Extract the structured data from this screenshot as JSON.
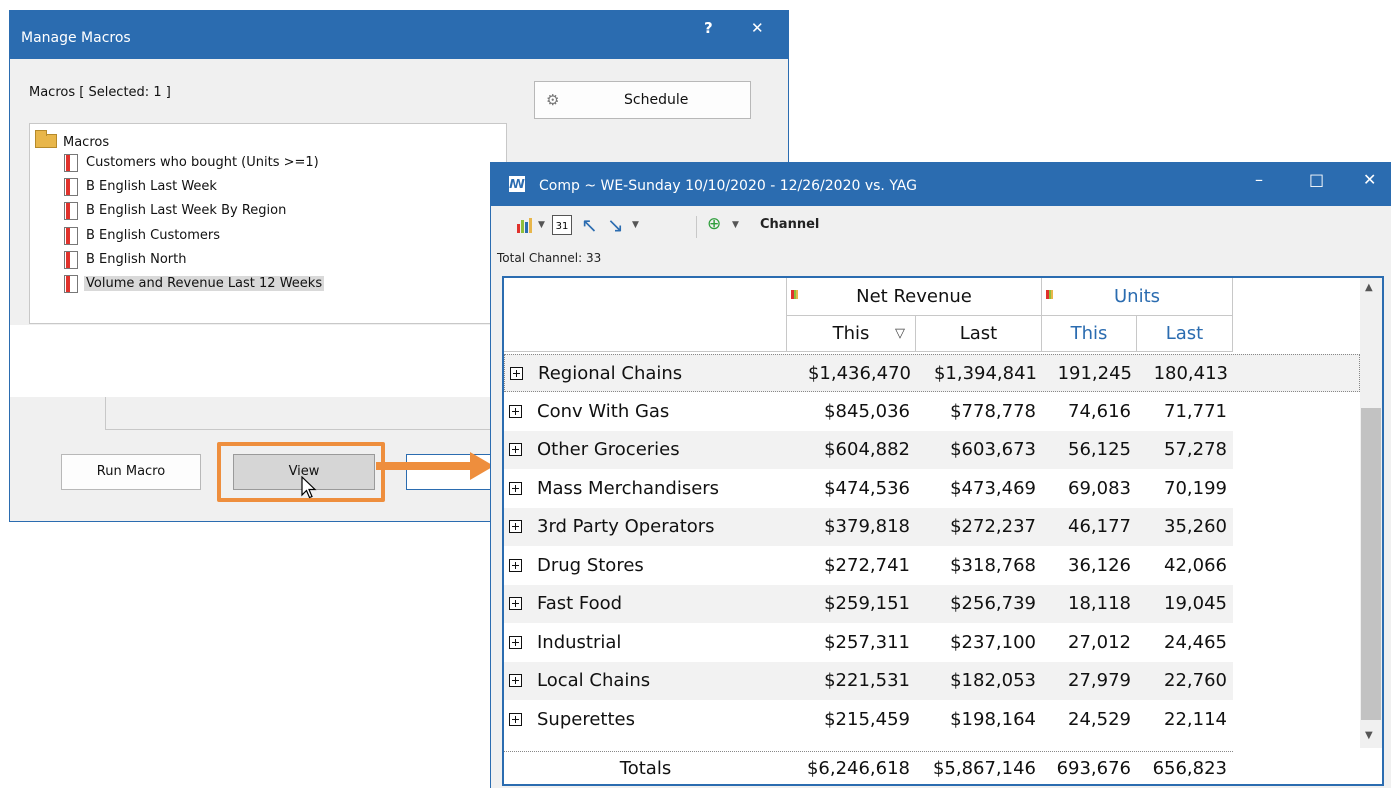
{
  "macro_dialog": {
    "title": "Manage Macros",
    "help_glyph": "?",
    "close_glyph": "✕",
    "selected_label": "Macros [ Selected: 1 ]",
    "schedule_label": "Schedule",
    "tree_root": "Macros",
    "macros": [
      "Customers who bought (Units >=1)",
      "B English Last Week",
      "B English Last Week By Region",
      "B English Customers",
      "B English North",
      "Volume and Revenue Last 12 Weeks"
    ],
    "selected_index": 5,
    "run_label": "Run Macro",
    "view_label": "View"
  },
  "comp_window": {
    "title": "Comp ~ WE-Sunday 10/10/2020 - 12/26/2020  vs. YAG",
    "minimize_glyph": "–",
    "maximize_glyph": "□",
    "close_glyph": "✕",
    "toolbar": {
      "dimension_label": "Channel",
      "calendar_day": "31"
    },
    "total_channel": "Total Channel: 33",
    "grid": {
      "groups": [
        "Net Revenue",
        "Units"
      ],
      "subheaders": [
        "This",
        "Last",
        "This",
        "Last"
      ],
      "rows": [
        {
          "name": "Regional Chains",
          "values": [
            "$1,436,470",
            "$1,394,841",
            "191,245",
            "180,413"
          ]
        },
        {
          "name": "Conv With Gas",
          "values": [
            "$845,036",
            "$778,778",
            "74,616",
            "71,771"
          ]
        },
        {
          "name": "Other Groceries",
          "values": [
            "$604,882",
            "$603,673",
            "56,125",
            "57,278"
          ]
        },
        {
          "name": "Mass Merchandisers",
          "values": [
            "$474,536",
            "$473,469",
            "69,083",
            "70,199"
          ]
        },
        {
          "name": "3rd Party Operators",
          "values": [
            "$379,818",
            "$272,237",
            "46,177",
            "35,260"
          ]
        },
        {
          "name": "Drug Stores",
          "values": [
            "$272,741",
            "$318,768",
            "36,126",
            "42,066"
          ]
        },
        {
          "name": "Fast Food",
          "values": [
            "$259,151",
            "$256,739",
            "18,118",
            "19,045"
          ]
        },
        {
          "name": "Industrial",
          "values": [
            "$257,311",
            "$237,100",
            "27,012",
            "24,465"
          ]
        },
        {
          "name": "Local Chains",
          "values": [
            "$221,531",
            "$182,053",
            "27,979",
            "22,760"
          ]
        },
        {
          "name": "Superettes",
          "values": [
            "$215,459",
            "$198,164",
            "24,529",
            "22,114"
          ]
        }
      ],
      "totals": {
        "label": "Totals",
        "values": [
          "$6,246,618",
          "$5,867,146",
          "693,676",
          "656,823"
        ]
      }
    }
  },
  "colors": {
    "title_bar": "#2b6cb0",
    "highlight_orange": "#ee8e3d",
    "units_header": "#2b6cb0"
  }
}
